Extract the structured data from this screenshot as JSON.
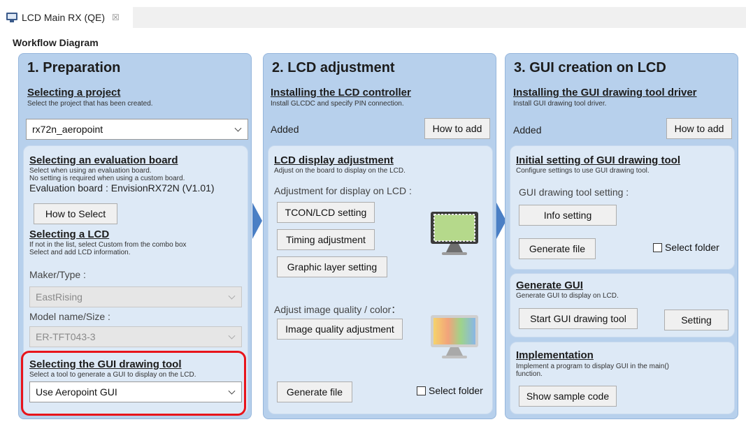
{
  "tab": {
    "title": "LCD Main RX (QE)",
    "close": "☒",
    "icon": "monitor-icon"
  },
  "workflow_title": "Workflow Diagram",
  "panel1": {
    "title": "1. Preparation",
    "project": {
      "title": "Selecting a project",
      "desc": "Select the project that has been created.",
      "value": "rx72n_aeropoint"
    },
    "eval_board": {
      "title": "Selecting an evaluation board",
      "desc1": "Select when using an evaluation board.",
      "desc2": "No setting is required when using a custom board.",
      "board_label": "Evaluation board : EnvisionRX72N (V1.01)",
      "how_button": "How to Select"
    },
    "lcd": {
      "title": "Selecting a LCD",
      "desc1": "If not in the list, select Custom from the combo box",
      "desc2": "Select and add LCD information.",
      "maker_label": "Maker/Type :",
      "maker_value": "EastRising",
      "model_label": "Model name/Size :",
      "model_value": "ER-TFT043-3"
    },
    "gui_tool": {
      "title": "Selecting the GUI drawing tool",
      "desc": "Select a tool to generate a GUI to display on the LCD.",
      "value": "Use Aeropoint GUI"
    }
  },
  "panel2": {
    "title": "2. LCD adjustment",
    "controller": {
      "title": "Installing the LCD controller",
      "desc": "Install GLCDC and specify PIN connection.",
      "status": "Added",
      "how_button": "How to add"
    },
    "display": {
      "title": "LCD display adjustment",
      "desc": "Adjust on the board to display on the LCD.",
      "label": "Adjustment for display on LCD :",
      "tcon_button": "TCON/LCD setting",
      "timing_button": "Timing adjustment",
      "graphic_button": "Graphic layer setting",
      "quality_label": "Adjust image quality / color：",
      "quality_button": "Image quality adjustment",
      "generate_button": "Generate file",
      "select_folder": "Select folder"
    }
  },
  "panel3": {
    "title": "3. GUI creation on LCD",
    "driver": {
      "title": "Installing the GUI drawing tool driver",
      "desc": "Install GUI drawing tool driver.",
      "status": "Added",
      "how_button": "How to add"
    },
    "initial": {
      "title": "Initial setting of GUI drawing tool",
      "desc": "Configure settings to use GUI drawing tool.",
      "label": "GUI drawing tool setting :",
      "info_button": "Info setting",
      "generate_button": "Generate file",
      "select_folder": "Select folder"
    },
    "generate_gui": {
      "title": "Generate GUI",
      "desc": "Generate GUI to display on LCD.",
      "start_button": "Start GUI drawing tool",
      "setting_button": "Setting"
    },
    "implementation": {
      "title": "Implementation",
      "desc1": "Implement a program to display GUI in the main()",
      "desc2": "function.",
      "sample_button": "Show sample code"
    }
  },
  "colors": {
    "panel_bg": "#b7d0ec",
    "sub_bg": "#dde9f6",
    "arrow": "#4a7fc5",
    "highlight": "#e8141b"
  }
}
